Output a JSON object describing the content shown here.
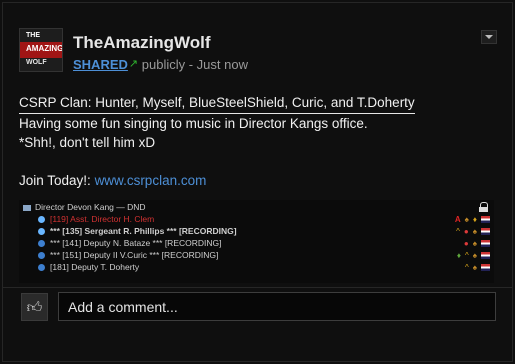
{
  "post": {
    "avatar": {
      "line1": "THE",
      "line2": "AMAZING",
      "line3": "WOLF"
    },
    "author": "TheAmazingWolf",
    "shared_label": "SHARED",
    "visibility": "publicly - Just now",
    "lines": [
      "CSRP Clan: Hunter, Myself, BlueSteelShield, Curic, and T.Doherty",
      "Having some fun singing to music in Director Kangs office.",
      "*Shh!, don't tell him xD"
    ],
    "join_label": "Join Today!: ",
    "join_link": "www.csrpclan.com"
  },
  "teamspeak": {
    "channel": "Director Devon Kang — DND",
    "users": [
      {
        "name": "[119] Asst. Director H. Clem",
        "style": "red"
      },
      {
        "name": "*** [135] Sergeant R. Phillips *** [RECORDING]",
        "style": "bold"
      },
      {
        "name": "*** [141] Deputy N. Bataze *** [RECORDING]",
        "style": "normal"
      },
      {
        "name": "*** [151] Deputy II V.Curic *** [RECORDING]",
        "style": "normal"
      },
      {
        "name": "[181] Deputy T. Doherty",
        "style": "normal"
      }
    ]
  },
  "comment": {
    "placeholder": "Add a comment..."
  },
  "colors": {
    "accent_link": "#4d8fd6",
    "background": "#0f0f0f",
    "recording_red": "#d23232"
  },
  "icons": {
    "share": "external-link-icon",
    "dropdown": "chevron-down-icon",
    "plus_one": "thumbs-up-icon",
    "lock": "lock-icon"
  }
}
